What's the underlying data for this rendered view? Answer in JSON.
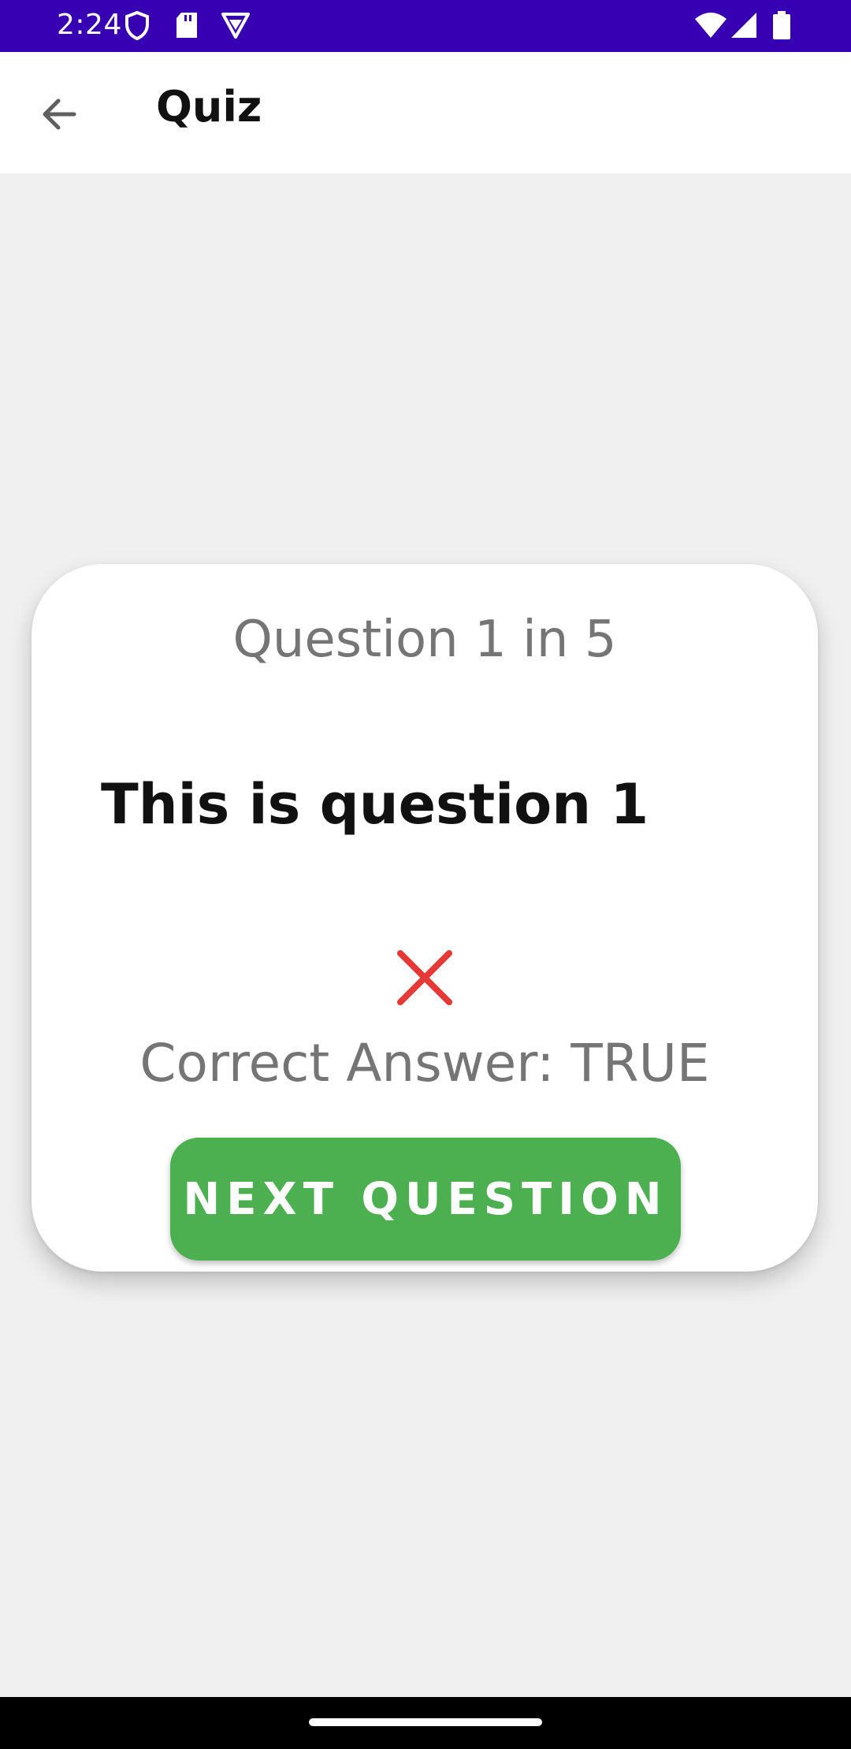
{
  "status_bar": {
    "time": "2:24",
    "icons": [
      "shield-icon",
      "sd-card-icon",
      "vpn-badge-icon",
      "wifi-icon",
      "signal-icon",
      "battery-icon"
    ],
    "background_color": "#3700b3"
  },
  "app_bar": {
    "title": "Quiz",
    "back_icon": "arrow-back-icon"
  },
  "quiz": {
    "counter": "Question 1 in 5",
    "question": "This is question 1",
    "result_icon": "close-icon",
    "result_color": "#e53935",
    "correct_answer": "Correct Answer: TRUE",
    "next_button_label": "NEXT QUESTION",
    "next_button_color": "#4caf50"
  }
}
